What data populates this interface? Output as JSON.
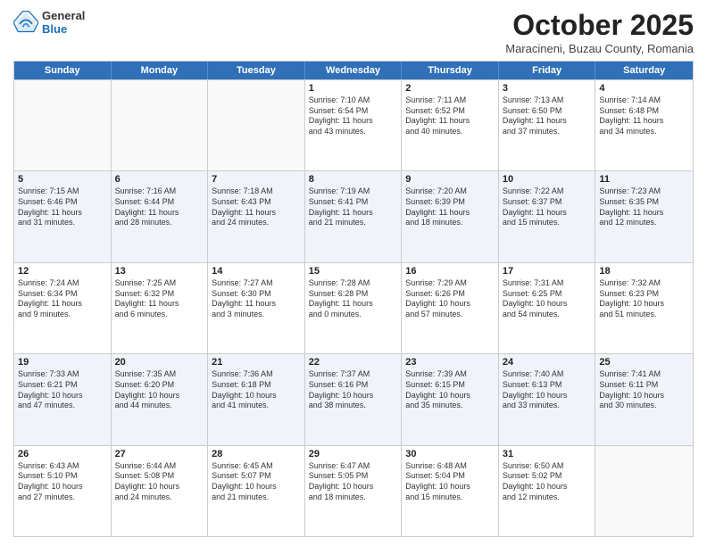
{
  "header": {
    "logo": {
      "general": "General",
      "blue": "Blue"
    },
    "title": "October 2025",
    "subtitle": "Maracineni, Buzau County, Romania"
  },
  "days": [
    "Sunday",
    "Monday",
    "Tuesday",
    "Wednesday",
    "Thursday",
    "Friday",
    "Saturday"
  ],
  "weeks": [
    [
      {
        "day": "",
        "info": []
      },
      {
        "day": "",
        "info": []
      },
      {
        "day": "",
        "info": []
      },
      {
        "day": "1",
        "info": [
          "Sunrise: 7:10 AM",
          "Sunset: 6:54 PM",
          "Daylight: 11 hours",
          "and 43 minutes."
        ]
      },
      {
        "day": "2",
        "info": [
          "Sunrise: 7:11 AM",
          "Sunset: 6:52 PM",
          "Daylight: 11 hours",
          "and 40 minutes."
        ]
      },
      {
        "day": "3",
        "info": [
          "Sunrise: 7:13 AM",
          "Sunset: 6:50 PM",
          "Daylight: 11 hours",
          "and 37 minutes."
        ]
      },
      {
        "day": "4",
        "info": [
          "Sunrise: 7:14 AM",
          "Sunset: 6:48 PM",
          "Daylight: 11 hours",
          "and 34 minutes."
        ]
      }
    ],
    [
      {
        "day": "5",
        "info": [
          "Sunrise: 7:15 AM",
          "Sunset: 6:46 PM",
          "Daylight: 11 hours",
          "and 31 minutes."
        ]
      },
      {
        "day": "6",
        "info": [
          "Sunrise: 7:16 AM",
          "Sunset: 6:44 PM",
          "Daylight: 11 hours",
          "and 28 minutes."
        ]
      },
      {
        "day": "7",
        "info": [
          "Sunrise: 7:18 AM",
          "Sunset: 6:43 PM",
          "Daylight: 11 hours",
          "and 24 minutes."
        ]
      },
      {
        "day": "8",
        "info": [
          "Sunrise: 7:19 AM",
          "Sunset: 6:41 PM",
          "Daylight: 11 hours",
          "and 21 minutes."
        ]
      },
      {
        "day": "9",
        "info": [
          "Sunrise: 7:20 AM",
          "Sunset: 6:39 PM",
          "Daylight: 11 hours",
          "and 18 minutes."
        ]
      },
      {
        "day": "10",
        "info": [
          "Sunrise: 7:22 AM",
          "Sunset: 6:37 PM",
          "Daylight: 11 hours",
          "and 15 minutes."
        ]
      },
      {
        "day": "11",
        "info": [
          "Sunrise: 7:23 AM",
          "Sunset: 6:35 PM",
          "Daylight: 11 hours",
          "and 12 minutes."
        ]
      }
    ],
    [
      {
        "day": "12",
        "info": [
          "Sunrise: 7:24 AM",
          "Sunset: 6:34 PM",
          "Daylight: 11 hours",
          "and 9 minutes."
        ]
      },
      {
        "day": "13",
        "info": [
          "Sunrise: 7:25 AM",
          "Sunset: 6:32 PM",
          "Daylight: 11 hours",
          "and 6 minutes."
        ]
      },
      {
        "day": "14",
        "info": [
          "Sunrise: 7:27 AM",
          "Sunset: 6:30 PM",
          "Daylight: 11 hours",
          "and 3 minutes."
        ]
      },
      {
        "day": "15",
        "info": [
          "Sunrise: 7:28 AM",
          "Sunset: 6:28 PM",
          "Daylight: 11 hours",
          "and 0 minutes."
        ]
      },
      {
        "day": "16",
        "info": [
          "Sunrise: 7:29 AM",
          "Sunset: 6:26 PM",
          "Daylight: 10 hours",
          "and 57 minutes."
        ]
      },
      {
        "day": "17",
        "info": [
          "Sunrise: 7:31 AM",
          "Sunset: 6:25 PM",
          "Daylight: 10 hours",
          "and 54 minutes."
        ]
      },
      {
        "day": "18",
        "info": [
          "Sunrise: 7:32 AM",
          "Sunset: 6:23 PM",
          "Daylight: 10 hours",
          "and 51 minutes."
        ]
      }
    ],
    [
      {
        "day": "19",
        "info": [
          "Sunrise: 7:33 AM",
          "Sunset: 6:21 PM",
          "Daylight: 10 hours",
          "and 47 minutes."
        ]
      },
      {
        "day": "20",
        "info": [
          "Sunrise: 7:35 AM",
          "Sunset: 6:20 PM",
          "Daylight: 10 hours",
          "and 44 minutes."
        ]
      },
      {
        "day": "21",
        "info": [
          "Sunrise: 7:36 AM",
          "Sunset: 6:18 PM",
          "Daylight: 10 hours",
          "and 41 minutes."
        ]
      },
      {
        "day": "22",
        "info": [
          "Sunrise: 7:37 AM",
          "Sunset: 6:16 PM",
          "Daylight: 10 hours",
          "and 38 minutes."
        ]
      },
      {
        "day": "23",
        "info": [
          "Sunrise: 7:39 AM",
          "Sunset: 6:15 PM",
          "Daylight: 10 hours",
          "and 35 minutes."
        ]
      },
      {
        "day": "24",
        "info": [
          "Sunrise: 7:40 AM",
          "Sunset: 6:13 PM",
          "Daylight: 10 hours",
          "and 33 minutes."
        ]
      },
      {
        "day": "25",
        "info": [
          "Sunrise: 7:41 AM",
          "Sunset: 6:11 PM",
          "Daylight: 10 hours",
          "and 30 minutes."
        ]
      }
    ],
    [
      {
        "day": "26",
        "info": [
          "Sunrise: 6:43 AM",
          "Sunset: 5:10 PM",
          "Daylight: 10 hours",
          "and 27 minutes."
        ]
      },
      {
        "day": "27",
        "info": [
          "Sunrise: 6:44 AM",
          "Sunset: 5:08 PM",
          "Daylight: 10 hours",
          "and 24 minutes."
        ]
      },
      {
        "day": "28",
        "info": [
          "Sunrise: 6:45 AM",
          "Sunset: 5:07 PM",
          "Daylight: 10 hours",
          "and 21 minutes."
        ]
      },
      {
        "day": "29",
        "info": [
          "Sunrise: 6:47 AM",
          "Sunset: 5:05 PM",
          "Daylight: 10 hours",
          "and 18 minutes."
        ]
      },
      {
        "day": "30",
        "info": [
          "Sunrise: 6:48 AM",
          "Sunset: 5:04 PM",
          "Daylight: 10 hours",
          "and 15 minutes."
        ]
      },
      {
        "day": "31",
        "info": [
          "Sunrise: 6:50 AM",
          "Sunset: 5:02 PM",
          "Daylight: 10 hours",
          "and 12 minutes."
        ]
      },
      {
        "day": "",
        "info": []
      }
    ]
  ]
}
